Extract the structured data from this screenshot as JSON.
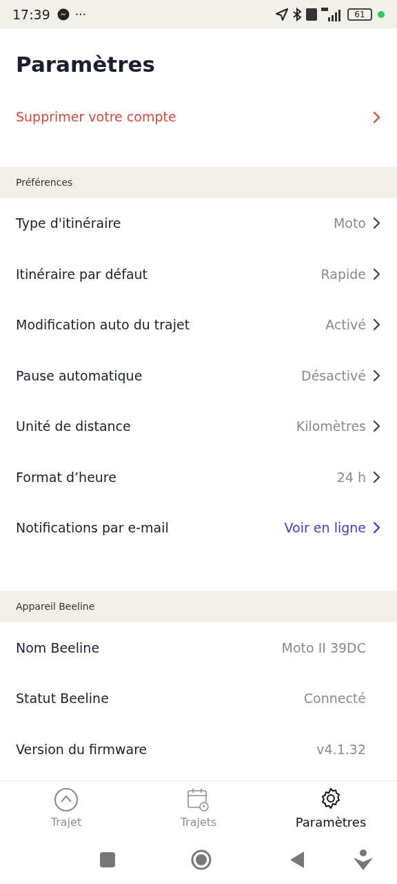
{
  "status_bar": {
    "time": "17:39",
    "more": "···",
    "battery": "61"
  },
  "title": "Paramètres",
  "delete_account": {
    "label": "Supprimer votre compte"
  },
  "sections": [
    {
      "header": "Préférences",
      "rows": [
        {
          "label": "Type d'itinéraire",
          "value": "Moto",
          "kind": "nav"
        },
        {
          "label": "Itinéraire par défaut",
          "value": "Rapide",
          "kind": "nav"
        },
        {
          "label": "Modification auto du trajet",
          "value": "Activé",
          "kind": "nav"
        },
        {
          "label": "Pause automatique",
          "value": "Désactivé",
          "kind": "nav"
        },
        {
          "label": "Unité de distance",
          "value": "Kilomètres",
          "kind": "nav"
        },
        {
          "label": "Format d’heure",
          "value": "24 h",
          "kind": "nav"
        },
        {
          "label": "Notifications par e-mail",
          "value": "Voir en ligne",
          "kind": "link"
        }
      ]
    },
    {
      "header": "Appareil Beeline",
      "rows": [
        {
          "label": "Nom Beeline",
          "value": "Moto II 39DC",
          "kind": "info"
        },
        {
          "label": "Statut Beeline",
          "value": "Connecté",
          "kind": "info"
        },
        {
          "label": "Version du firmware",
          "value": "v4.1.32",
          "kind": "info"
        }
      ]
    }
  ],
  "bottom_nav": [
    {
      "label": "Trajet",
      "selected": false
    },
    {
      "label": "Trajets",
      "selected": false
    },
    {
      "label": "Paramètres",
      "selected": true
    }
  ]
}
